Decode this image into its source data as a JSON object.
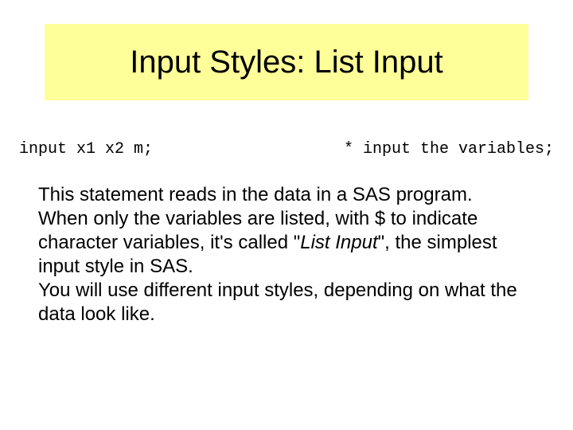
{
  "title": "Input Styles: List Input",
  "code": {
    "left": "input x1 x2 m;",
    "right": "* input the variables;"
  },
  "paragraphs": {
    "p1": "This statement reads in the data in a SAS program.",
    "p2a": "When only the variables are listed, with $ to indicate character variables, it's called \"",
    "p2b": "List Input",
    "p2c": "\", the simplest input style in SAS.",
    "p3": "You will use different input styles, depending on what the data look like."
  }
}
